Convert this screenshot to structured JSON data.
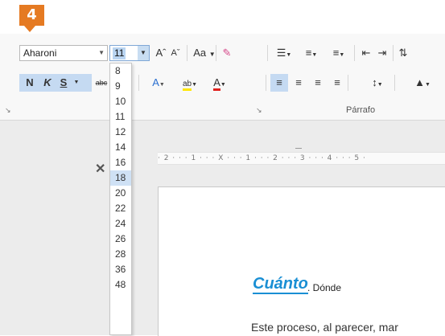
{
  "step": "4",
  "ribbon": {
    "font_name": "Aharoni",
    "font_size": "11",
    "grow_font": "Aˆ",
    "shrink_font": "Aˇ",
    "change_case": "Aa",
    "bold": "N",
    "italic": "K",
    "underline": "S",
    "strikethrough": "abc",
    "font_color_letter": "A",
    "highlight_letter": "ab",
    "paragraph_group_label": "Párrafo"
  },
  "size_options": [
    "8",
    "9",
    "10",
    "11",
    "12",
    "14",
    "16",
    "18",
    "20",
    "22",
    "24",
    "26",
    "28",
    "36",
    "48"
  ],
  "size_selected": "18",
  "ruler_text": "· 2 · · · 1 · · · X · · · 1 · · · 2 · · · 3 · · · 4 · · · 5 ·",
  "document": {
    "title_word": "Cuánto",
    "title_rest": ". Dónde",
    "body_line": "Este proceso, al parecer, mar"
  },
  "colors": {
    "accent": "#e57a22",
    "highlight": "#1a8fd4",
    "selected": "#cfe1f5"
  }
}
